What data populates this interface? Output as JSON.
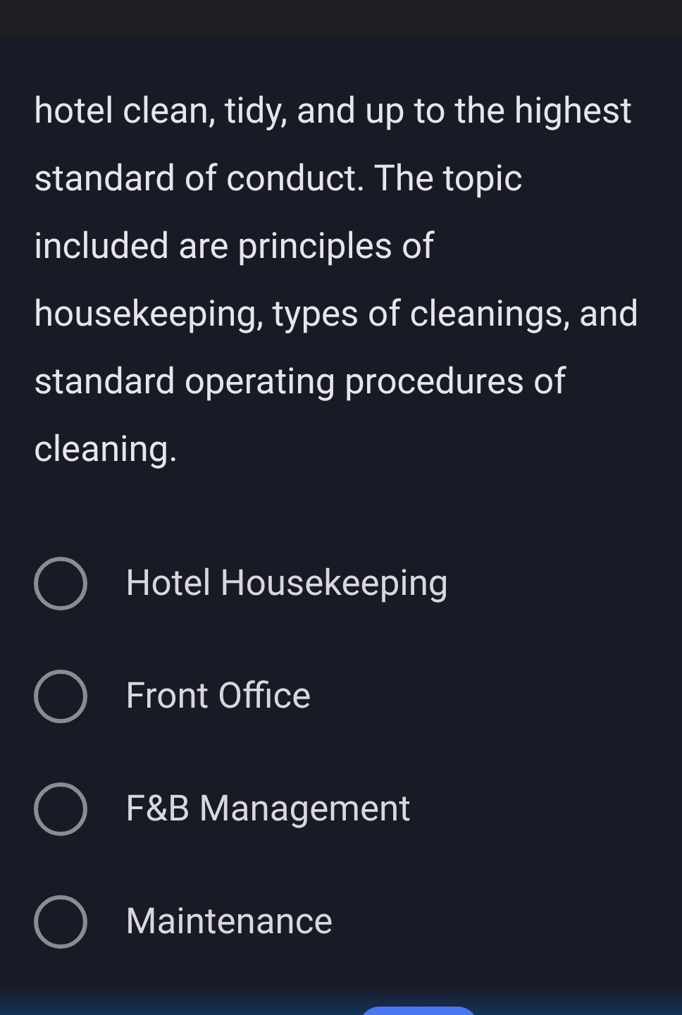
{
  "question": {
    "text": "hotel clean, tidy, and up to the highest standard of conduct. The topic included are principles of housekeeping, types of cleanings, and standard operating procedures of cleaning."
  },
  "options": [
    {
      "label": "Hotel Housekeeping",
      "selected": false
    },
    {
      "label": "Front Office",
      "selected": false
    },
    {
      "label": "F&B Management",
      "selected": false
    },
    {
      "label": "Maintenance",
      "selected": false
    }
  ]
}
